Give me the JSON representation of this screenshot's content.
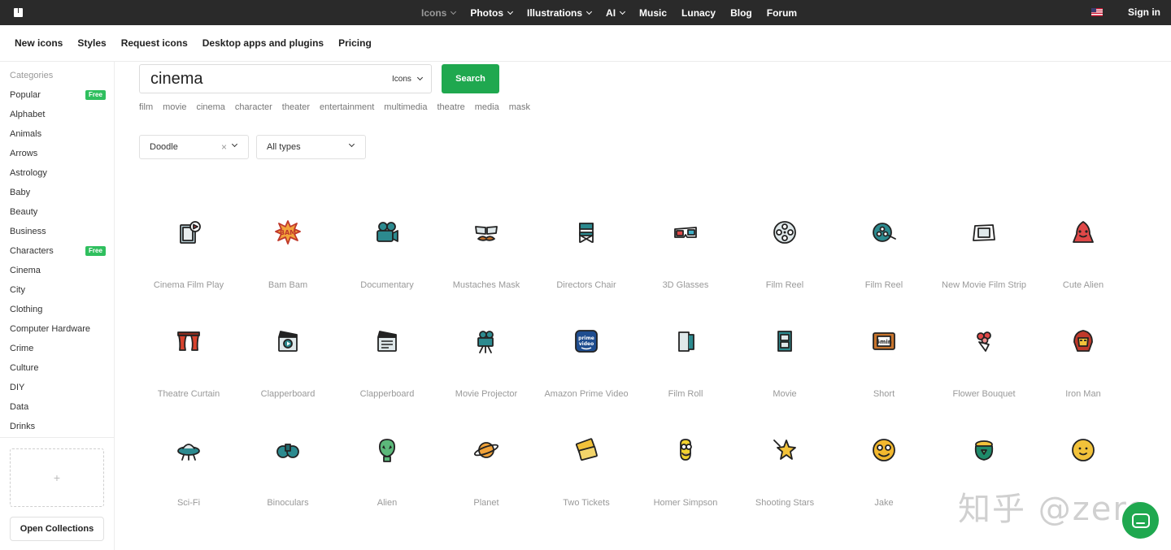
{
  "topbar": {
    "nav": [
      {
        "label": "Icons",
        "dropdown": true,
        "active": false
      },
      {
        "label": "Photos",
        "dropdown": true,
        "active": true
      },
      {
        "label": "Illustrations",
        "dropdown": true,
        "active": true
      },
      {
        "label": "AI",
        "dropdown": true,
        "active": true
      },
      {
        "label": "Music",
        "dropdown": false,
        "active": true
      },
      {
        "label": "Lunacy",
        "dropdown": false,
        "active": true
      },
      {
        "label": "Blog",
        "dropdown": false,
        "active": true
      },
      {
        "label": "Forum",
        "dropdown": false,
        "active": true
      }
    ],
    "signin": "Sign in"
  },
  "subnav": [
    "New icons",
    "Styles",
    "Request icons",
    "Desktop apps and plugins",
    "Pricing"
  ],
  "sidebar": {
    "title": "Categories",
    "badge": "Free",
    "items": [
      {
        "label": "Popular",
        "free": true
      },
      {
        "label": "Alphabet",
        "free": false
      },
      {
        "label": "Animals",
        "free": false
      },
      {
        "label": "Arrows",
        "free": false
      },
      {
        "label": "Astrology",
        "free": false
      },
      {
        "label": "Baby",
        "free": false
      },
      {
        "label": "Beauty",
        "free": false
      },
      {
        "label": "Business",
        "free": false
      },
      {
        "label": "Characters",
        "free": true
      },
      {
        "label": "Cinema",
        "free": false
      },
      {
        "label": "City",
        "free": false
      },
      {
        "label": "Clothing",
        "free": false
      },
      {
        "label": "Computer Hardware",
        "free": false
      },
      {
        "label": "Crime",
        "free": false
      },
      {
        "label": "Culture",
        "free": false
      },
      {
        "label": "DIY",
        "free": false
      },
      {
        "label": "Data",
        "free": false
      },
      {
        "label": "Drinks",
        "free": false
      }
    ],
    "dropzone_plus": "+",
    "open_collections": "Open Collections"
  },
  "search": {
    "value": "cinema",
    "type": "Icons",
    "button": "Search",
    "tags": [
      "film",
      "movie",
      "cinema",
      "character",
      "theater",
      "entertainment",
      "multimedia",
      "theatre",
      "media",
      "mask"
    ]
  },
  "filters": {
    "style": "Doodle",
    "clear": "×",
    "types": "All types"
  },
  "icons": [
    {
      "label": "Cinema Film Play",
      "icon": "film-play-icon"
    },
    {
      "label": "Bam Bam",
      "icon": "bam-icon"
    },
    {
      "label": "Documentary",
      "icon": "camera-icon"
    },
    {
      "label": "Mustaches Mask",
      "icon": "mustache-mask-icon"
    },
    {
      "label": "Directors Chair",
      "icon": "directors-chair-icon"
    },
    {
      "label": "3D Glasses",
      "icon": "3d-glasses-icon"
    },
    {
      "label": "Film Reel",
      "icon": "film-reel-icon"
    },
    {
      "label": "Film Reel",
      "icon": "film-reel-tape-icon"
    },
    {
      "label": "New Movie Film Strip",
      "icon": "film-strip-icon"
    },
    {
      "label": "Cute Alien",
      "icon": "cute-alien-icon"
    },
    {
      "label": "Theatre Curtain",
      "icon": "theatre-curtain-icon"
    },
    {
      "label": "Clapperboard",
      "icon": "clapperboard-play-icon"
    },
    {
      "label": "Clapperboard",
      "icon": "clapperboard-icon"
    },
    {
      "label": "Movie Projector",
      "icon": "movie-projector-icon"
    },
    {
      "label": "Amazon Prime Video",
      "icon": "prime-video-icon"
    },
    {
      "label": "Film Roll",
      "icon": "film-roll-icon"
    },
    {
      "label": "Movie",
      "icon": "movie-icon"
    },
    {
      "label": "Short",
      "icon": "short-film-icon"
    },
    {
      "label": "Flower Bouquet",
      "icon": "flower-bouquet-icon"
    },
    {
      "label": "Iron Man",
      "icon": "iron-man-icon"
    },
    {
      "label": "Sci-Fi",
      "icon": "ufo-icon"
    },
    {
      "label": "Binoculars",
      "icon": "binoculars-icon"
    },
    {
      "label": "Alien",
      "icon": "alien-icon"
    },
    {
      "label": "Planet",
      "icon": "planet-icon"
    },
    {
      "label": "Two Tickets",
      "icon": "two-tickets-icon"
    },
    {
      "label": "Homer Simpson",
      "icon": "homer-simpson-icon"
    },
    {
      "label": "Shooting Stars",
      "icon": "shooting-stars-icon"
    },
    {
      "label": "Jake",
      "icon": "jake-icon"
    },
    {
      "label": "",
      "icon": "pot-of-gold-icon"
    },
    {
      "label": "",
      "icon": "face-icon"
    }
  ],
  "watermark": "知乎 @zero"
}
